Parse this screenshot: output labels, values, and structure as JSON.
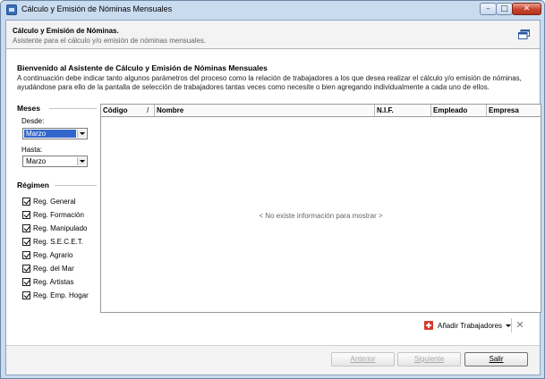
{
  "window": {
    "title": "Cálculo y Emisión de Nóminas Mensuales",
    "controls": {
      "minimize": "–",
      "maximize": "□",
      "close": "✕"
    }
  },
  "header": {
    "title": "Cálculo y Emisión de Nóminas.",
    "subtitle": "Asistente para el cálculo y/o emisión de nóminas mensuales.",
    "icon": "restore-window-icon"
  },
  "welcome": {
    "title": "Bienvenido al Asistente de Cálculo y Emisión de Nóminas Mensuales",
    "line1": "A continuación debe indicar tanto algunos parámetros del proceso como la relación de trabajadores a los que desea realizar el cálculo y/o emisión de nóminas,",
    "line2": "ayudándose para ello de la pantalla de selección de trabajadores tantas veces como necesite o bien agregando individualmente a cada uno de ellos."
  },
  "meses": {
    "title": "Meses",
    "desde_label": "Desde:",
    "desde_value": "Marzo",
    "hasta_label": "Hasta:",
    "hasta_value": "Marzo"
  },
  "regimen": {
    "title": "Régimen",
    "items": [
      {
        "label": "Reg. General",
        "checked": true
      },
      {
        "label": "Reg. Formación",
        "checked": true
      },
      {
        "label": "Reg. Manipulado",
        "checked": true
      },
      {
        "label": "Reg. S.E.C.E.T.",
        "checked": true
      },
      {
        "label": "Reg. Agrario",
        "checked": true
      },
      {
        "label": "Reg. del Mar",
        "checked": true
      },
      {
        "label": "Reg. Artistas",
        "checked": true
      },
      {
        "label": "Reg. Emp. Hogar",
        "checked": true
      }
    ]
  },
  "grid": {
    "columns": [
      "Código",
      "Nombre",
      "N.I.F.",
      "Empleado",
      "Empresa"
    ],
    "sort_indicator": "/",
    "empty_message": "< No existe información para mostrar >"
  },
  "toolbar": {
    "add_label": "Añadir Trabajadores",
    "remove_symbol": "✕"
  },
  "footer": {
    "back_label": "Anterior",
    "next_label": "Siguiente",
    "exit_label": "Salir"
  }
}
